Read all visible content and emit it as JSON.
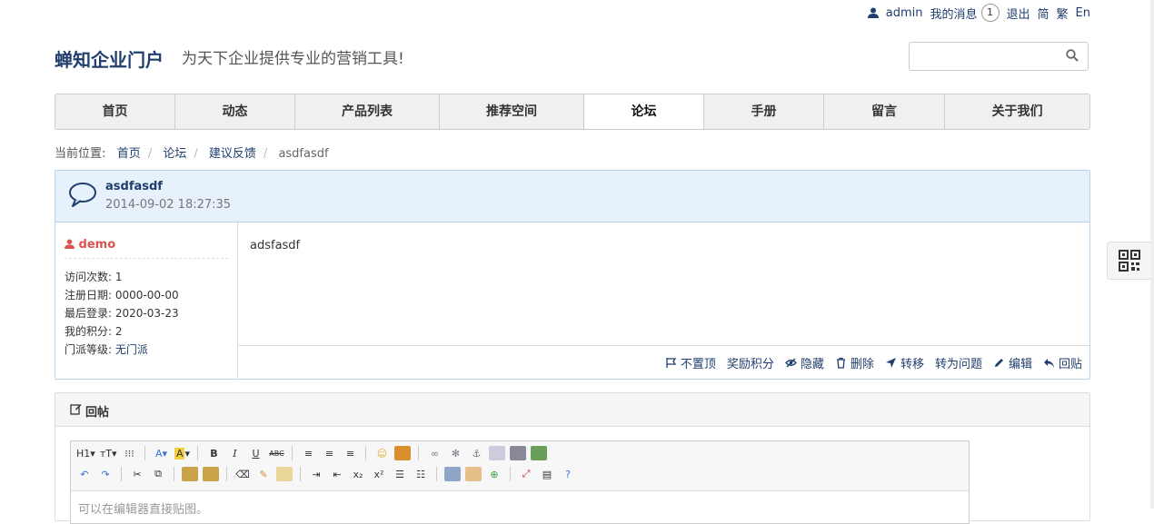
{
  "topbar": {
    "username": "admin",
    "messages_label": "我的消息",
    "messages_count": "1",
    "logout_label": "退出",
    "lang_simplified": "简",
    "lang_traditional": "繁",
    "lang_english": "En"
  },
  "header": {
    "logo": "蝉知企业门户",
    "slogan": "为天下企业提供专业的营销工具!"
  },
  "search": {
    "placeholder": ""
  },
  "nav": {
    "tabs": [
      {
        "label": "首页"
      },
      {
        "label": "动态"
      },
      {
        "label": "产品列表"
      },
      {
        "label": "推荐空间"
      },
      {
        "label": "论坛",
        "active": true
      },
      {
        "label": "手册"
      },
      {
        "label": "留言"
      },
      {
        "label": "关于我们"
      }
    ]
  },
  "breadcrumb": {
    "prefix": "当前位置:",
    "items": [
      "首页",
      "论坛",
      "建议反馈"
    ],
    "current": "asdfasdf"
  },
  "thread": {
    "title": "asdfasdf",
    "date": "2014-09-02 18:27:35",
    "author": "demo",
    "stats": [
      {
        "label": "访问次数:",
        "value": "1"
      },
      {
        "label": "注册日期:",
        "value": "0000-00-00"
      },
      {
        "label": "最后登录:",
        "value": "2020-03-23"
      },
      {
        "label": "我的积分:",
        "value": "2"
      },
      {
        "label": "门派等级:",
        "value": "无门派"
      }
    ],
    "content": "adsfasdf",
    "actions": {
      "unsticky": "不置顶",
      "reward": "奖励积分",
      "hide": "隐藏",
      "delete": "删除",
      "move": "转移",
      "to_question": "转为问题",
      "edit": "编辑",
      "reply": "回贴"
    }
  },
  "reply": {
    "title": "回帖",
    "editor_placeholder": "可以在编辑器直接贴图。",
    "toolbar_row1": [
      "H1",
      "тT",
      "⁝⁝⁝",
      "A",
      "A",
      "B",
      "I",
      "U",
      "ABC"
    ],
    "toolbar_row2": [
      "↶",
      "↷",
      "✂",
      "⧉",
      "x₂",
      "x²"
    ]
  },
  "colors": {
    "link": "#1f3e6e",
    "author": "#d9534f",
    "thread_header_bg": "#e7f1fb",
    "thread_border": "#b9d3ea"
  }
}
